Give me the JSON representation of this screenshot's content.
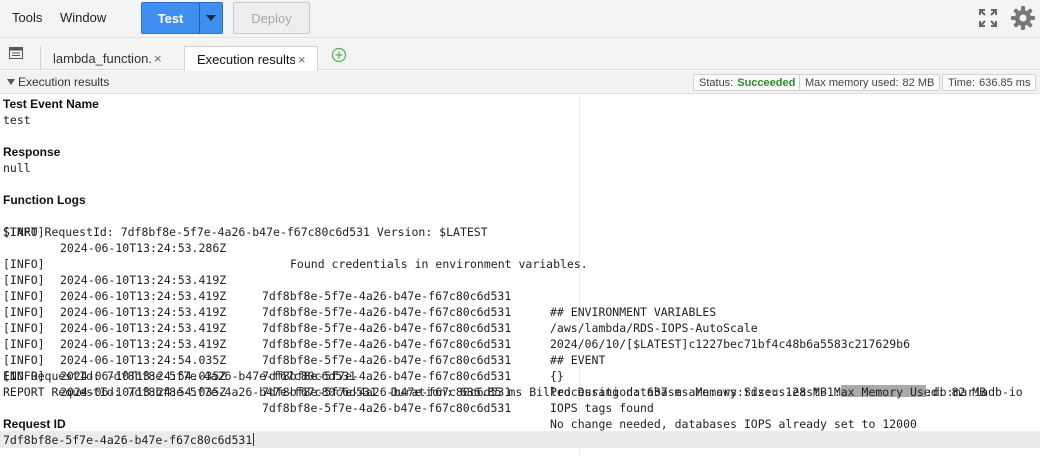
{
  "menu": {
    "tools": "Tools",
    "window": "Window"
  },
  "toolbar": {
    "test_label": "Test",
    "deploy_label": "Deploy"
  },
  "tabs": [
    {
      "label": "lambda_function.py",
      "close": "×"
    },
    {
      "label": "Execution results",
      "close": "×"
    }
  ],
  "results": {
    "title": "Execution results",
    "status_label": "Status:",
    "status_value": "Succeeded",
    "memory_label": "Max memory used:",
    "memory_value": "82 MB",
    "time_label": "Time:",
    "time_value": "636.85 ms",
    "status_color": "#2c8a2c"
  },
  "content": {
    "test_event_name_label": "Test Event Name",
    "test_event_name": "test",
    "response_label": "Response",
    "response": "null",
    "function_logs_label": "Function Logs",
    "first_log": {
      "level": "[INFO]",
      "timestamp": "2024-06-10T13:24:53.286Z",
      "message": "Found credentials in environment variables."
    },
    "start_line": "START RequestId: 7df8bf8e-5f7e-4a26-b47e-f67c80c6d531 Version: $LATEST",
    "logs": [
      {
        "level": "[INFO]",
        "timestamp": "2024-06-10T13:24:53.419Z",
        "request_id": "7df8bf8e-5f7e-4a26-b47e-f67c80c6d531",
        "message": "## ENVIRONMENT VARIABLES"
      },
      {
        "level": "[INFO]",
        "timestamp": "2024-06-10T13:24:53.419Z",
        "request_id": "7df8bf8e-5f7e-4a26-b47e-f67c80c6d531",
        "message": "/aws/lambda/RDS-IOPS-AutoScale"
      },
      {
        "level": "[INFO]",
        "timestamp": "2024-06-10T13:24:53.419Z",
        "request_id": "7df8bf8e-5f7e-4a26-b47e-f67c80c6d531",
        "message": "2024/06/10/[$LATEST]c1227bec71bf4c48b6a5583c217629b6"
      },
      {
        "level": "[INFO]",
        "timestamp": "2024-06-10T13:24:53.419Z",
        "request_id": "7df8bf8e-5f7e-4a26-b47e-f67c80c6d531",
        "message": "## EVENT"
      },
      {
        "level": "[INFO]",
        "timestamp": "2024-06-10T13:24:53.419Z",
        "request_id": "7df8bf8e-5f7e-4a26-b47e-f67c80c6d531",
        "message": "{}"
      },
      {
        "level": "[INFO]",
        "timestamp": "2024-06-10T13:24:54.035Z",
        "request_id": "7df8bf8e-5f7e-4a26-b47e-f67c80c6d531",
        "message": "Processing database arn:aws:rds:us-east-1:",
        "message_suffix": ":db:mariadb-io",
        "redacted": true
      },
      {
        "level": "[INFO]",
        "timestamp": "2024-06-10T13:24:54.035Z",
        "request_id": "7df8bf8e-5f7e-4a26-b47e-f67c80c6d531",
        "message": "IOPS tags found"
      },
      {
        "level": "[INFO]",
        "timestamp": "2024-06-10T13:24:54.035Z",
        "request_id": "7df8bf8e-5f7e-4a26-b47e-f67c80c6d531",
        "message": "No change needed, databases IOPS already set to 12000"
      }
    ],
    "end_line": "END RequestId: 7df8bf8e-5f7e-4a26-b47e-f67c80c6d531",
    "report_line": "REPORT RequestId: 7df8bf8e-5f7e-4a26-b47e-f67c80c6d531  Duration: 636.85 ms Billed Duration: 637 ms Memory Size: 128 MB Max Memory Used: 82 MB",
    "request_id_label": "Request ID",
    "request_id": "7df8bf8e-5f7e-4a26-b47e-f67c80c6d531"
  },
  "icons": {
    "fullscreen": "fullscreen-icon",
    "settings": "gear-icon",
    "tabs_menu": "tabs-menu-icon",
    "add_tab": "add-tab-icon",
    "collapse": "triangle-down-icon"
  },
  "colors": {
    "primary_button": "#3f8ff0",
    "add_tab": "#4caf50"
  }
}
